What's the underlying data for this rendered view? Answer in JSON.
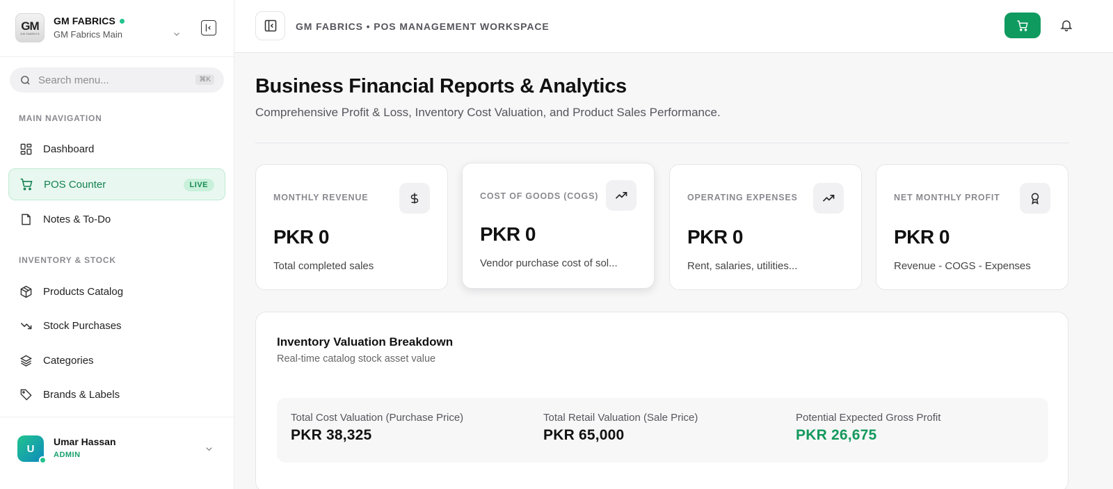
{
  "sidebar": {
    "brand": {
      "logo_text": "GM",
      "logo_sub": "GM FABRICS",
      "name": "GM FABRICS",
      "branch": "GM Fabrics Main"
    },
    "search": {
      "placeholder": "Search menu...",
      "shortcut": "⌘K"
    },
    "sections": {
      "main": "MAIN NAVIGATION",
      "inventory": "INVENTORY & STOCK"
    },
    "items": [
      {
        "label": "Dashboard",
        "icon": "grid-icon"
      },
      {
        "label": "POS Counter",
        "icon": "cart-icon",
        "badge": "LIVE",
        "active": true
      },
      {
        "label": "Notes & To-Do",
        "icon": "note-icon"
      },
      {
        "label": "Products Catalog",
        "icon": "box-icon"
      },
      {
        "label": "Stock Purchases",
        "icon": "trend-down-icon"
      },
      {
        "label": "Categories",
        "icon": "layers-icon"
      },
      {
        "label": "Brands & Labels",
        "icon": "tag-icon"
      }
    ],
    "user": {
      "initial": "U",
      "name": "Umar Hassan",
      "role": "ADMIN"
    }
  },
  "header": {
    "title": "GM FABRICS • POS MANAGEMENT WORKSPACE"
  },
  "main": {
    "title": "Business Financial Reports & Analytics",
    "subtitle": "Comprehensive Profit & Loss, Inventory Cost Valuation, and Product Sales Performance.",
    "kpis": [
      {
        "label": "MONTHLY REVENUE",
        "value": "PKR 0",
        "desc": "Total completed sales",
        "icon": "dollar-icon"
      },
      {
        "label": "COST OF GOODS (COGS)",
        "value": "PKR 0",
        "desc": "Vendor purchase cost of sol...",
        "icon": "trend-up-icon"
      },
      {
        "label": "OPERATING EXPENSES",
        "value": "PKR 0",
        "desc": "Rent, salaries, utilities...",
        "icon": "trend-up-icon"
      },
      {
        "label": "NET MONTHLY PROFIT",
        "value": "PKR 0",
        "desc": "Revenue - COGS - Expenses",
        "icon": "award-icon"
      }
    ],
    "inventory": {
      "title": "Inventory Valuation Breakdown",
      "subtitle": "Real-time catalog stock asset value",
      "columns": [
        {
          "label": "Total Cost Valuation (Purchase Price)",
          "value": "PKR 38,325"
        },
        {
          "label": "Total Retail Valuation (Sale Price)",
          "value": "PKR 65,000"
        },
        {
          "label": "Potential Expected Gross Profit",
          "value": "PKR 26,675"
        }
      ]
    }
  },
  "colors": {
    "accent": "#0f9a5f",
    "accent_light": "#e8f8f0",
    "profit": "#14995c"
  }
}
